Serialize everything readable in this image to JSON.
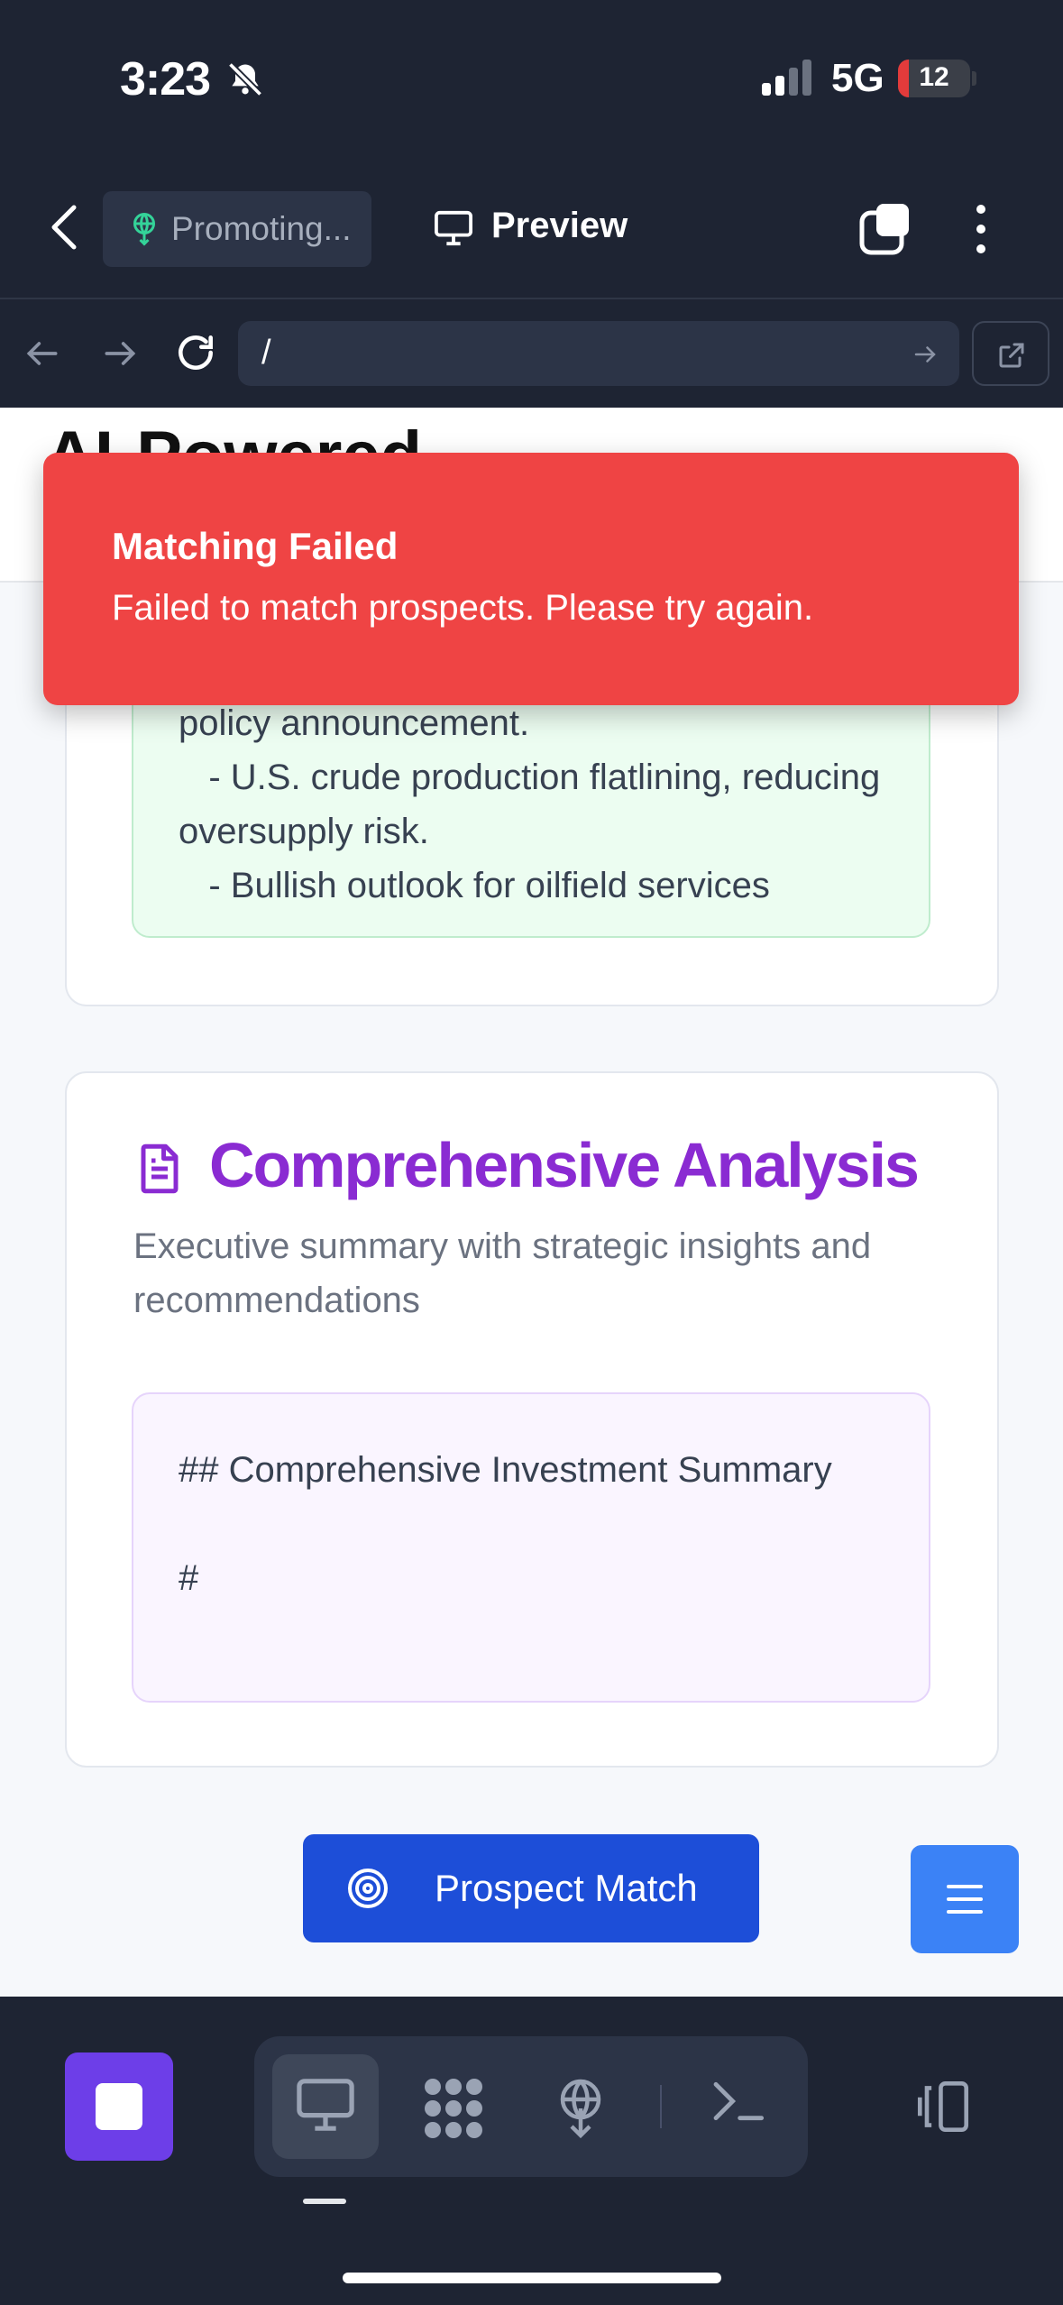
{
  "status_bar": {
    "time": "3:23",
    "network": "5G",
    "battery": "12"
  },
  "browser_header": {
    "project_name": "Promoting...",
    "preview_label": "Preview"
  },
  "url_bar": {
    "url": "/"
  },
  "page": {
    "header_title": "AI-Powered",
    "market_card": {
      "text": "policy announcement.\n   - U.S. crude production flatlining, reducing oversupply risk.\n   - Bullish outlook for oilfield services"
    },
    "analysis_card": {
      "title": "Comprehensive Analysis",
      "description": "Executive summary with strategic insights and recommendations",
      "content": "## Comprehensive Investment Summary\n\n#"
    },
    "prospect_button_label": "Prospect Match"
  },
  "toast": {
    "title": "Matching Failed",
    "message": "Failed to match prospects. Please try again."
  },
  "colors": {
    "chrome_bg": "#1e2433",
    "toast_bg": "#ef4444",
    "accent_purple": "#8a2bd2",
    "button_blue": "#1d4ed8",
    "menu_blue": "#3b82f6",
    "stop_purple": "#6d3ee8"
  },
  "icons": [
    "bell-off-icon",
    "signal-icon",
    "back-chevron-icon",
    "globe-pin-icon",
    "monitor-icon",
    "tabs-icon",
    "kebab-icon",
    "arrow-left-icon",
    "arrow-right-icon",
    "reload-icon",
    "external-link-icon",
    "document-icon",
    "target-icon",
    "hamburger-icon",
    "stop-icon",
    "integrations-icon",
    "deploy-icon",
    "terminal-icon",
    "layout-toggle-icon"
  ]
}
